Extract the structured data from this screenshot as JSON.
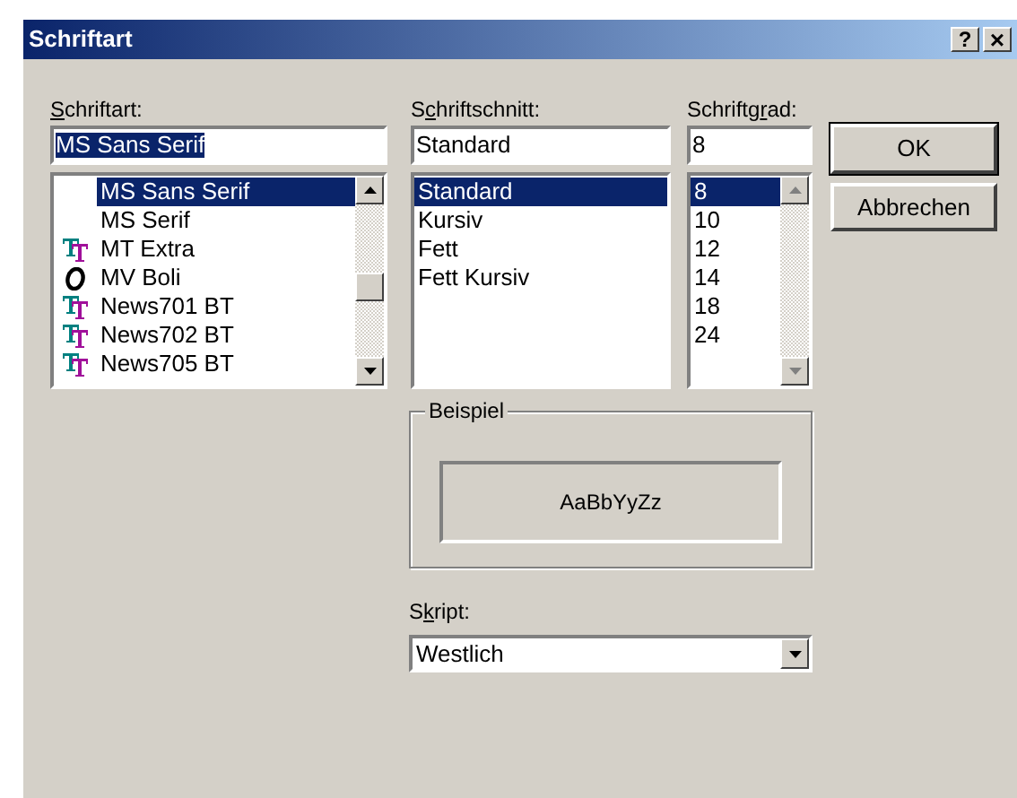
{
  "window": {
    "title": "Schriftart",
    "help_glyph": "?",
    "close_glyph": "×"
  },
  "font": {
    "label": {
      "key": "S",
      "post": "chriftart:"
    },
    "value": "MS Sans Serif",
    "items": [
      {
        "name": "MS Sans Serif",
        "kind": "none",
        "selected": true
      },
      {
        "name": "MS Serif",
        "kind": "none",
        "selected": false
      },
      {
        "name": "MT Extra",
        "kind": "truetype",
        "selected": false
      },
      {
        "name": "MV Boli",
        "kind": "opentype",
        "selected": false
      },
      {
        "name": "News701 BT",
        "kind": "truetype",
        "selected": false
      },
      {
        "name": "News702 BT",
        "kind": "truetype",
        "selected": false
      },
      {
        "name": "News705 BT",
        "kind": "truetype",
        "selected": false
      }
    ]
  },
  "style": {
    "label": {
      "pre": "S",
      "key": "c",
      "post": "hriftschnitt:"
    },
    "value": "Standard",
    "items": [
      {
        "name": "Standard",
        "selected": true
      },
      {
        "name": "Kursiv",
        "selected": false
      },
      {
        "name": "Fett",
        "selected": false
      },
      {
        "name": "Fett Kursiv",
        "selected": false
      }
    ]
  },
  "size": {
    "label": {
      "pre": "Schriftg",
      "key": "r",
      "post": "ad:"
    },
    "value": "8",
    "items": [
      {
        "name": "8",
        "selected": true
      },
      {
        "name": "10",
        "selected": false
      },
      {
        "name": "12",
        "selected": false
      },
      {
        "name": "14",
        "selected": false
      },
      {
        "name": "18",
        "selected": false
      },
      {
        "name": "24",
        "selected": false
      }
    ]
  },
  "buttons": [
    "OK",
    "Abbrechen"
  ],
  "sample": {
    "title": "Beispiel",
    "text": "AaBbYyZz"
  },
  "script": {
    "label": {
      "pre": "S",
      "key": "k",
      "post": "ript:"
    },
    "value": "Westlich"
  }
}
